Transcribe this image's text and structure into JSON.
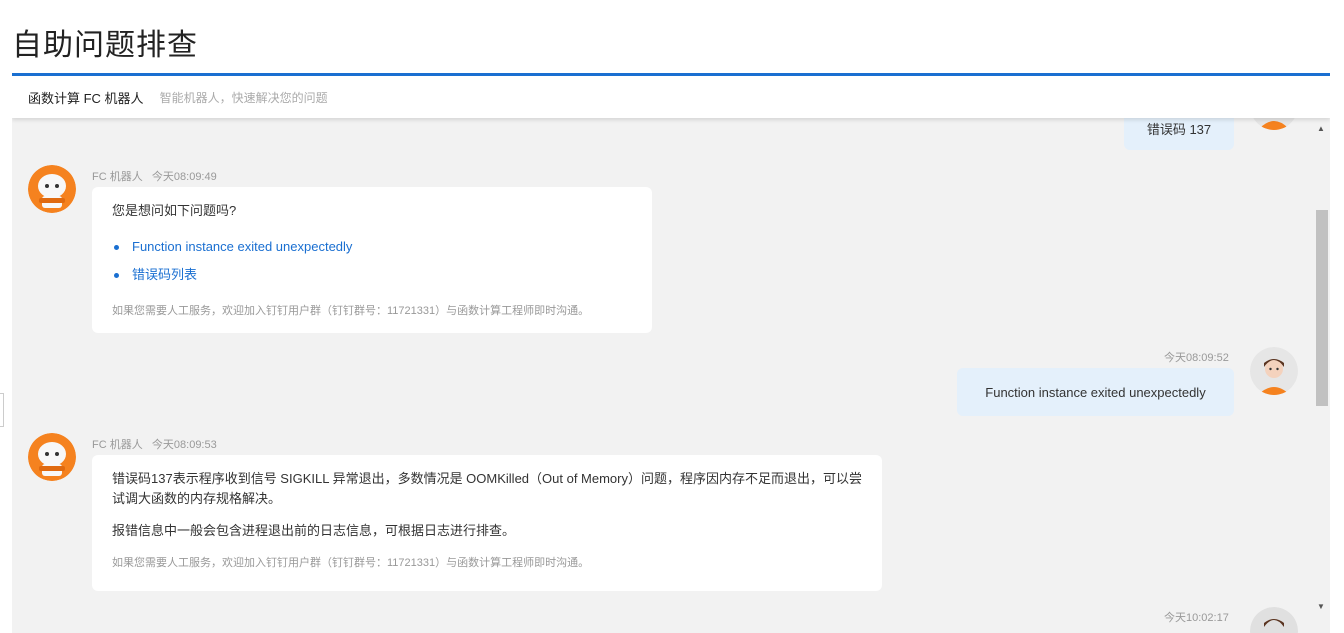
{
  "page": {
    "title": "自助问题排查"
  },
  "header": {
    "bot_name": "函数计算 FC 机器人",
    "bot_desc": "智能机器人，快速解决您的问题"
  },
  "messages": {
    "user0": {
      "text": "错误码 137"
    },
    "bot1": {
      "sender": "FC 机器人",
      "time": "今天08:09:49",
      "question": "您是想问如下问题吗?",
      "links": [
        "Function instance exited unexpectedly",
        "错误码列表"
      ],
      "footnote": "如果您需要人工服务，欢迎加入钉钉用户群（钉钉群号：11721331）与函数计算工程师即时沟通。"
    },
    "user1": {
      "time": "今天08:09:52",
      "text": "Function instance exited unexpectedly"
    },
    "bot2": {
      "sender": "FC 机器人",
      "time": "今天08:09:53",
      "para1": "错误码137表示程序收到信号 SIGKILL 异常退出，多数情况是 OOMKilled（Out of Memory）问题，程序因内存不足而退出，可以尝试调大函数的内存规格解决。",
      "para2": "报错信息中一般会包含进程退出前的日志信息，可根据日志进行排查。",
      "footnote": "如果您需要人工服务，欢迎加入钉钉用户群（钉钉群号：11721331）与函数计算工程师即时沟通。"
    },
    "user2": {
      "time": "今天10:02:17"
    }
  },
  "icons": {
    "bot_avatar": "robot-avatar-icon",
    "user_avatar": "user-avatar-icon"
  },
  "colors": {
    "accent": "#1a6fd1",
    "user_bubble": "#e4f0fb",
    "bot_orange": "#f5821f"
  }
}
